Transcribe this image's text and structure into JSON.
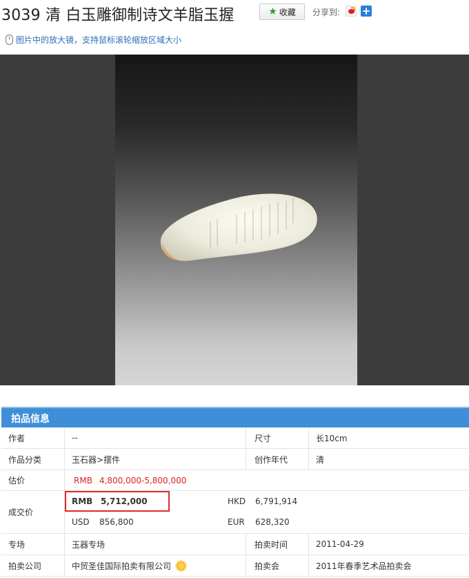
{
  "header": {
    "title": "3039 清 白玉雕御制诗文羊脂玉握",
    "favorite_label": "收藏",
    "share_label": "分享到:"
  },
  "zoom_hint": "图片中的放大镜，支持鼠标滚轮缩放区域大小",
  "info": {
    "section_title": "拍品信息",
    "author_label": "作者",
    "author_value": "--",
    "size_label": "尺寸",
    "size_value": "长10cm",
    "category_label": "作品分类",
    "category_value": "玉石器>摆件",
    "era_label": "创作年代",
    "era_value": "清",
    "estimate_label": "估价",
    "estimate_currency": "RMB",
    "estimate_value": "4,800,000-5,800,000",
    "sold_label": "成交价",
    "sold_prices": {
      "rmb_currency": "RMB",
      "rmb_value": "5,712,000",
      "hkd_currency": "HKD",
      "hkd_value": "6,791,914",
      "usd_currency": "USD",
      "usd_value": "856,800",
      "eur_currency": "EUR",
      "eur_value": "628,320"
    },
    "session_label": "专场",
    "session_value": "玉器专场",
    "auction_time_label": "拍卖时间",
    "auction_time_value": "2011-04-29",
    "house_label": "拍卖公司",
    "house_value": "中贸圣佳国际拍卖有限公司",
    "sale_label": "拍卖会",
    "sale_value": "2011年春季艺术品拍卖会"
  },
  "colors": {
    "accent_blue": "#3e8fd8",
    "price_red": "#d22222",
    "link_blue": "#2e6fb7"
  }
}
